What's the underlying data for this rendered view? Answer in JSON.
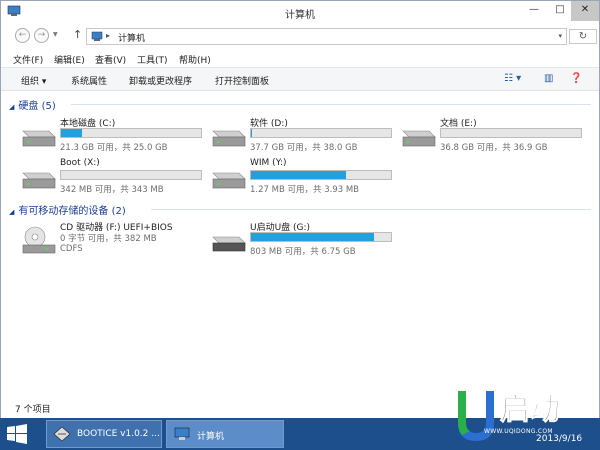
{
  "window": {
    "title": "计算机"
  },
  "address": {
    "path": "计算机"
  },
  "menu": {
    "file": "文件(F)",
    "edit": "编辑(E)",
    "view": "查看(V)",
    "tools": "工具(T)",
    "help": "帮助(H)"
  },
  "toolbar": {
    "organize": "组织 ▾",
    "properties": "系统属性",
    "uninstall": "卸载或更改程序",
    "control_panel": "打开控制面板"
  },
  "groups": {
    "hard_disks": "硬盘 (5)",
    "removable": "有可移动存储的设备 (2)"
  },
  "drives": [
    {
      "name": "本地磁盘 (C:)",
      "info": "21.3 GB 可用，共 25.0 GB",
      "used_fraction": 0.15
    },
    {
      "name": "软件 (D:)",
      "info": "37.7 GB 可用，共 38.0 GB",
      "used_fraction": 0.01
    },
    {
      "name": "文档 (E:)",
      "info": "36.8 GB 可用，共 36.9 GB",
      "used_fraction": 0.0
    },
    {
      "name": "Boot (X:)",
      "info": "342 MB 可用，共 343 MB",
      "used_fraction": 0.0
    },
    {
      "name": "WIM (Y:)",
      "info": "1.27 MB 可用，共 3.93 MB",
      "used_fraction": 0.68
    }
  ],
  "removable_drives": [
    {
      "name": "CD 驱动器 (F:) UEFI+BIOS",
      "info": "0 字节 可用，共 382 MB",
      "fs": "CDFS"
    },
    {
      "name": "U启动U盘 (G:)",
      "info": "803 MB 可用，共 6.75 GB",
      "used_fraction": 0.88
    }
  ],
  "status": {
    "items": "7 个项目"
  },
  "taskbar": {
    "app1": "BOOTICE v1.0.2 ...",
    "app2": "计算机",
    "date": "2013/9/16"
  },
  "logo": {
    "url": "WWW.UQIDONG.COM",
    "text": "启动"
  },
  "colors": {
    "accent": "#26a0da",
    "taskbar": "#1d4f8c",
    "group_header": "#1a3e96"
  }
}
